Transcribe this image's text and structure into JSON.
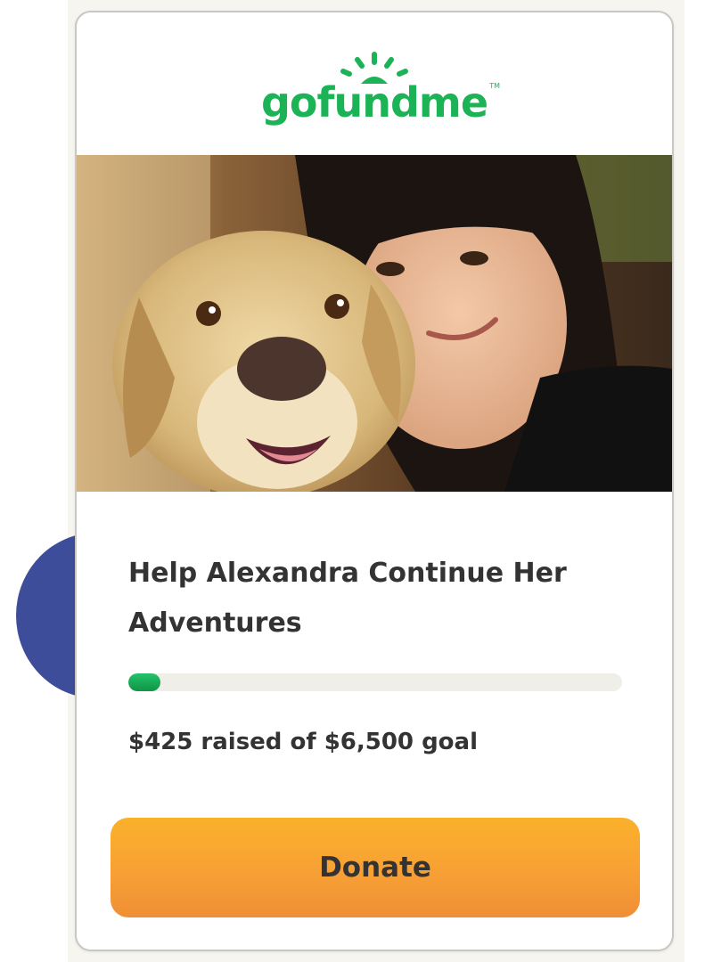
{
  "brand": {
    "logo_text": "gofundme",
    "trademark": "TM",
    "logo_color": "#1bb356"
  },
  "campaign": {
    "title": "Help Alexandra Continue Her Adventures",
    "photo": "campaign-photo-dog-and-woman",
    "raised_text": "$425 raised of $6,500 goal",
    "raised_amount": 425,
    "goal_amount": 6500,
    "progress_fraction": 0.065
  },
  "actions": {
    "donate_label": "Donate"
  },
  "colors": {
    "accent_green": "#1bb356",
    "donate_orange": "#f7a035",
    "decor_blue": "#3e4d9a",
    "text_dark": "#333333"
  }
}
